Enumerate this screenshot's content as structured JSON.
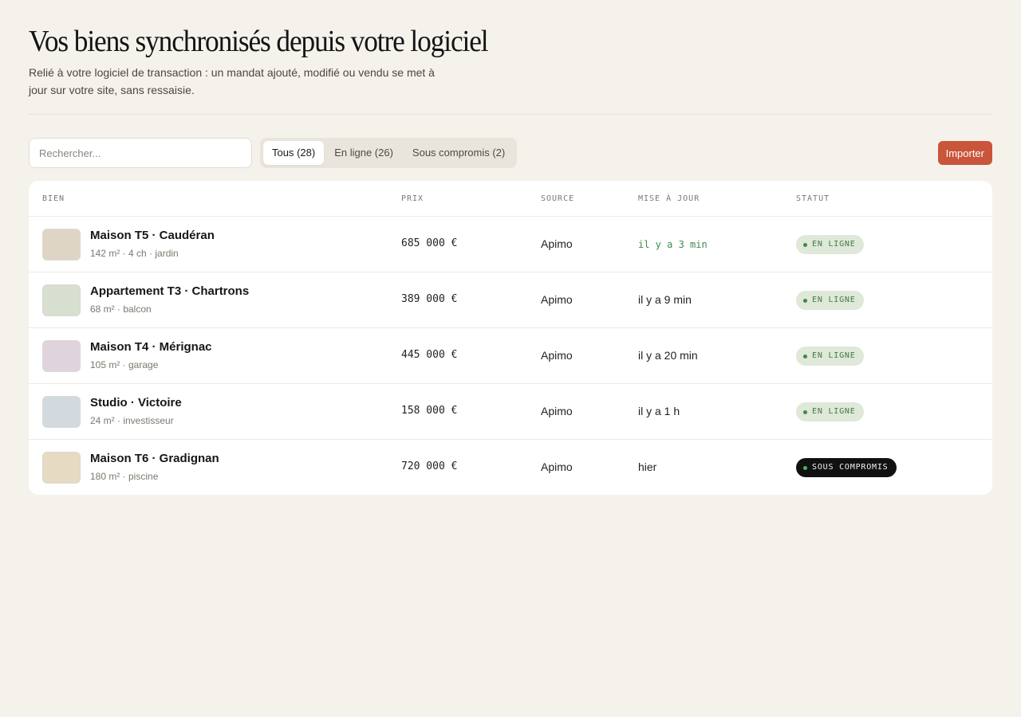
{
  "header": {
    "title": "Vos biens synchronisés depuis votre logiciel",
    "subtitle": "Relié à votre logiciel de transaction : un mandat ajouté, modifié ou vendu se met à jour sur votre site, sans ressaisie."
  },
  "toolbar": {
    "search_placeholder": "Rechercher...",
    "tabs": [
      {
        "label": "Tous (28)",
        "active": true
      },
      {
        "label": "En ligne (26)",
        "active": false
      },
      {
        "label": "Sous compromis (2)",
        "active": false
      }
    ],
    "import_label": "Importer"
  },
  "table": {
    "columns": {
      "bien": "BIEN",
      "prix": "PRIX",
      "source": "SOURCE",
      "mise_a_jour": "MISE À JOUR",
      "statut": "STATUT"
    },
    "rows": [
      {
        "name": "Maison T5 · Caudéran",
        "details": "142 m² · 4 ch · jardin",
        "price": "685 000 €",
        "source": "Apimo",
        "updated": "il y a 3 min",
        "status": "EN LIGNE",
        "thumb_color": "#e6dccb"
      },
      {
        "name": "Appartement T3 · Chartrons",
        "details": "68 m² · balcon",
        "price": "389 000 €",
        "source": "Apimo",
        "updated": "il y a 9 min",
        "status": "EN LIGNE",
        "thumb_color": "#dde6d6"
      },
      {
        "name": "Maison T4 · Mérignac",
        "details": "105 m² · garage",
        "price": "445 000 €",
        "source": "Apimo",
        "updated": "il y a 20 min",
        "status": "EN LIGNE",
        "thumb_color": "#e6dbe5"
      },
      {
        "name": "Studio · Victoire",
        "details": "24 m² · investisseur",
        "price": "158 000 €",
        "source": "Apimo",
        "updated": "il y a 1 h",
        "status": "EN LIGNE",
        "thumb_color": "#d9e1e6"
      },
      {
        "name": "Maison T6 · Gradignan",
        "details": "180 m² · piscine",
        "price": "720 000 €",
        "source": "Apimo",
        "updated": "hier",
        "status": "SOUS COMPROMIS",
        "thumb_color": "#ede1c8"
      }
    ]
  },
  "colors": {
    "accent": "#c9553b",
    "background": "#f5f2ec",
    "online_badge": "#dfe8d9",
    "pending_badge": "#111111"
  }
}
